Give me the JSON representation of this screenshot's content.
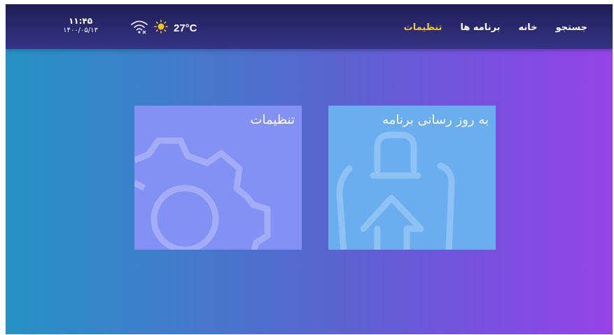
{
  "status_bar": {
    "time": "۱۱:۴۵",
    "date": "۱۴۰۰/۰۵/۱۳",
    "temperature": "27°C",
    "wifi_icon": "wifi-disconnected-icon",
    "weather_icon": "sun-icon"
  },
  "nav": {
    "items": [
      {
        "label": "جستجو",
        "active": false
      },
      {
        "label": "خانه",
        "active": false
      },
      {
        "label": "برنامه ها",
        "active": false
      },
      {
        "label": "تنظیمات",
        "active": true
      }
    ],
    "active_color": "#f5c842"
  },
  "tiles": {
    "update": {
      "label": "به روز رسانی برنامه",
      "icon": "bag-upload-icon",
      "color": "#6aaef0"
    },
    "settings": {
      "label": "تنظیمات",
      "icon": "gear-icon",
      "color": "#8391f5"
    }
  }
}
